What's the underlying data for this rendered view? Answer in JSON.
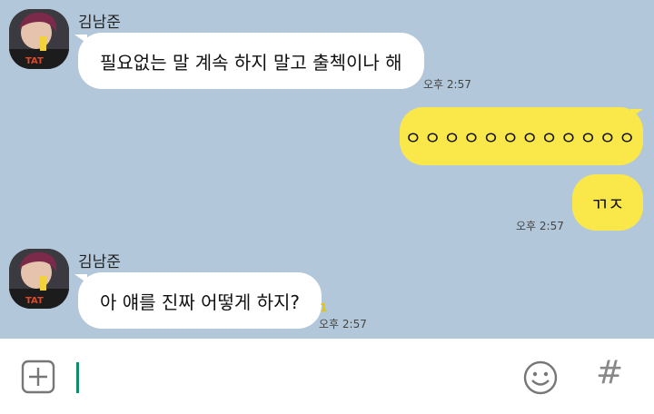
{
  "messages": {
    "m1": {
      "sender": "김남준",
      "text": "필요없는 말 계속 하지 말고 출첵이나 해",
      "time": "오후 2:57"
    },
    "m2": {
      "text": "ㅇㅇㅇㅇㅇㅇㅇㅇㅇㅇㅇㅇ"
    },
    "m3": {
      "text": "ㄲㅈ",
      "time": "오후 2:57"
    },
    "m4": {
      "sender": "김남준",
      "text": "아 얘를 진짜 어떻게 하지?",
      "unread": "1",
      "time": "오후 2:57"
    }
  },
  "input": {
    "value": ""
  },
  "icons": {
    "attach": "plus-square-icon",
    "emoji": "smiley-icon",
    "hash": "#"
  },
  "colors": {
    "background": "#b2c7d9",
    "incoming_bubble": "#ffffff",
    "outgoing_bubble": "#fae84b",
    "cursor": "#0d8c6a"
  }
}
